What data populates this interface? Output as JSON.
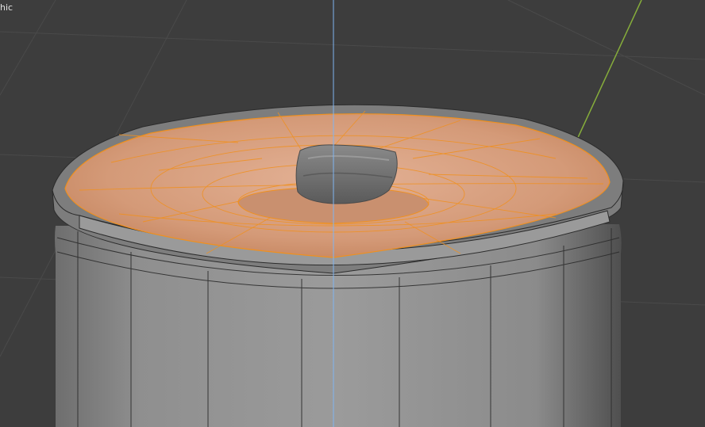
{
  "viewport": {
    "view_label": "hic",
    "mode": "edit-mode",
    "shading": "solid",
    "colors": {
      "background": "#3d3d3d",
      "grid_line": "#4a4a4a",
      "axis_y": "#86ad3b",
      "axis_z": "#7fb4f0",
      "mesh_body": "#8a8a8a",
      "mesh_wire": "#2b2b2b",
      "selected_face": "#d9a283",
      "selected_edge": "#f0901e",
      "knob": "#6a6a6a"
    }
  },
  "objects": [
    {
      "name": "can-body",
      "selected": false
    },
    {
      "name": "lid-top",
      "selected": true
    },
    {
      "name": "handle-knob",
      "selected": false
    }
  ]
}
